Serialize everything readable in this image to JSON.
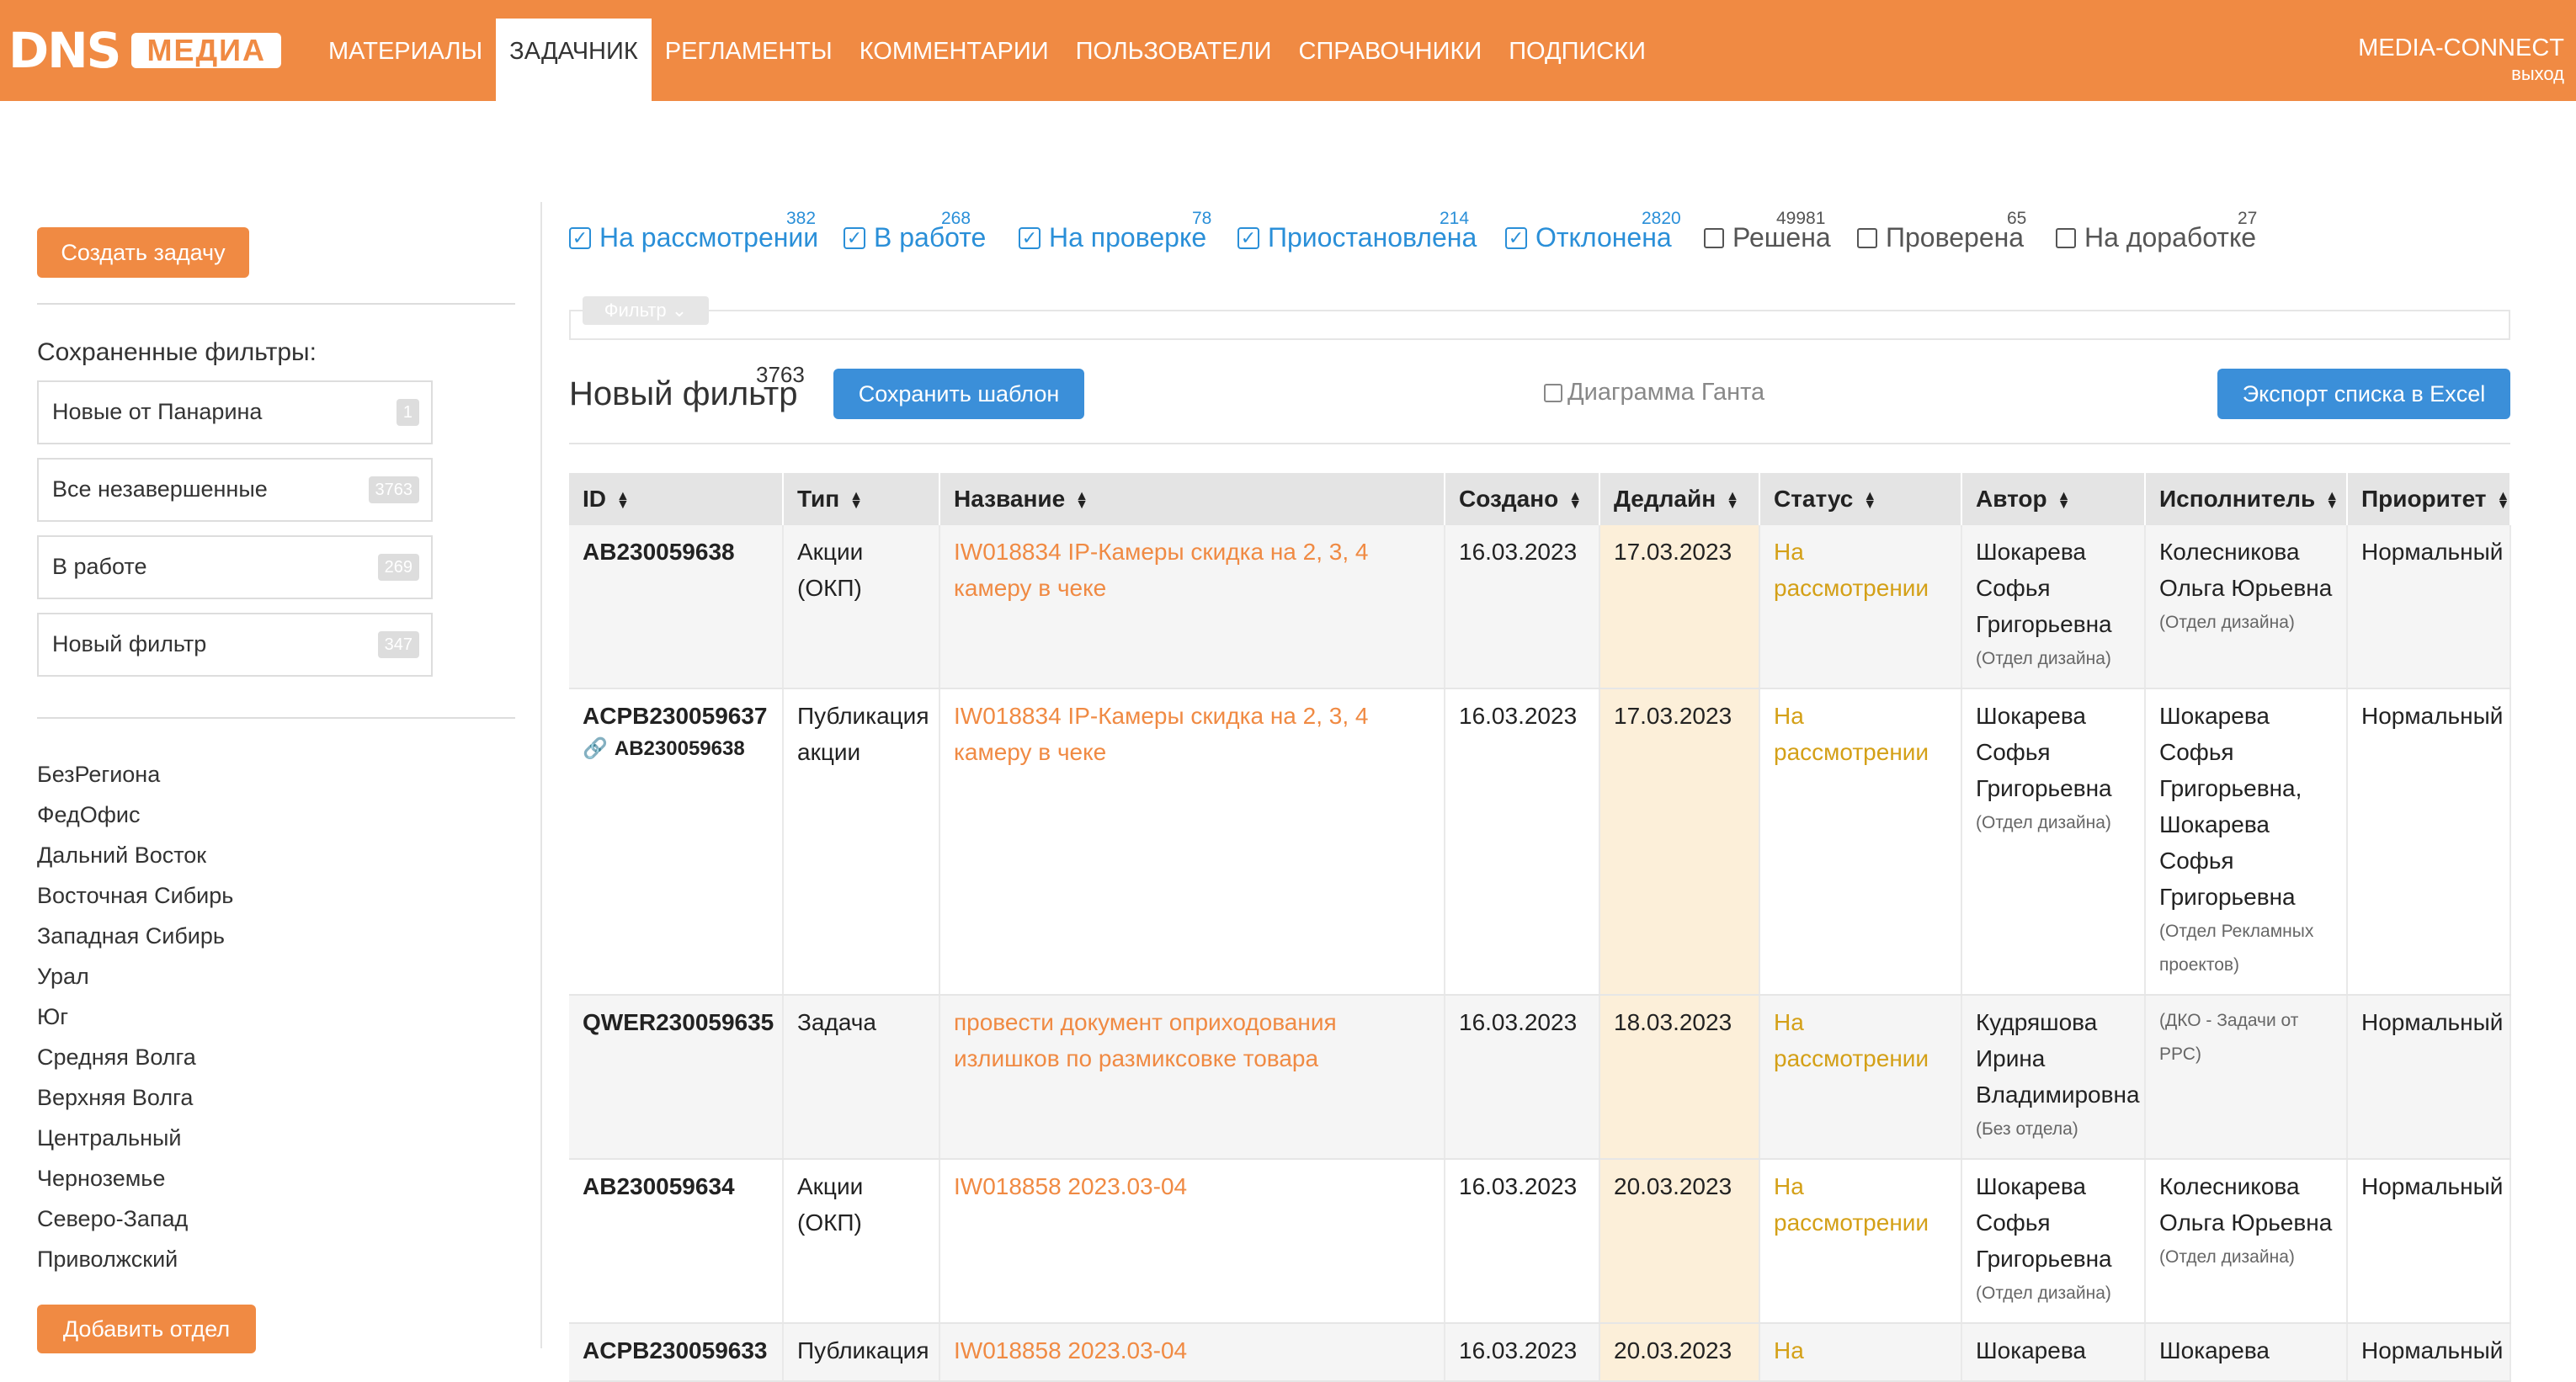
{
  "header": {
    "logo_dns": "DNS",
    "logo_media": "МЕДИА",
    "nav": [
      {
        "label": "МАТЕРИАЛЫ",
        "active": false
      },
      {
        "label": "ЗАДАЧНИК",
        "active": true
      },
      {
        "label": "РЕГЛАМЕНТЫ",
        "active": false
      },
      {
        "label": "КОММЕНТАРИИ",
        "active": false
      },
      {
        "label": "ПОЛЬЗОВАТЕЛИ",
        "active": false
      },
      {
        "label": "СПРАВОЧНИКИ",
        "active": false
      },
      {
        "label": "ПОДПИСКИ",
        "active": false
      }
    ],
    "user_name": "MEDIA-CONNECT",
    "logout": "ВЫХОД",
    "accent_color": "#f08a43"
  },
  "sidebar": {
    "create_button": "Создать задачу",
    "saved_title": "Сохраненные фильтры:",
    "saved_filters": [
      {
        "name": "Новые от Панарина",
        "count": "1"
      },
      {
        "name": "Все незавершенные",
        "count": "3763"
      },
      {
        "name": "В работе",
        "count": "269"
      },
      {
        "name": "Новый фильтр",
        "count": "347"
      }
    ],
    "regions": [
      "БезРегиона",
      "ФедОфис",
      "Дальний Восток",
      "Восточная Сибирь",
      "Западная Сибирь",
      "Урал",
      "Юг",
      "Средняя Волга",
      "Верхняя Волга",
      "Центральный",
      "Черноземье",
      "Северо-Запад",
      "Приволжский"
    ],
    "add_button": "Добавить отдел"
  },
  "statuses": [
    {
      "label": "На рассмотрении",
      "count": "382",
      "checked": true
    },
    {
      "label": "В работе",
      "count": "268",
      "checked": true
    },
    {
      "label": "На проверке",
      "count": "78",
      "checked": true
    },
    {
      "label": "Приостановлена",
      "count": "214",
      "checked": true
    },
    {
      "label": "Отклонена",
      "count": "2820",
      "checked": true
    },
    {
      "label": "Решена",
      "count": "49981",
      "checked": false
    },
    {
      "label": "Проверена",
      "count": "65",
      "checked": false
    },
    {
      "label": "На доработке",
      "count": "27",
      "checked": false
    }
  ],
  "filter_tag": "Фильтр",
  "filter_title": "Новый фильтр",
  "filter_count": "3763",
  "save_template": "Сохранить шаблон",
  "gantt_label": "Диаграмма Ганта",
  "export_button": "Экспорт списка в Excel",
  "table": {
    "columns": [
      "ID",
      "Тип",
      "Название",
      "Создано",
      "Дедлайн",
      "Статус",
      "Автор",
      "Исполнитель",
      "Приоритет"
    ],
    "rows": [
      {
        "id": "AB230059638",
        "sub_id": "",
        "type": "Акции (ОКП)",
        "name": "IW018834 IP-Камеры скидка на 2, 3, 4 камеру в чеке",
        "created": "16.03.2023",
        "deadline": "17.03.2023",
        "status": "На рассмотрении",
        "author": "Шокарева Софья Григорьевна",
        "author_dept": "(Отдел дизайна)",
        "executor": "Колесникова Ольга Юрьевна",
        "executor_dept": "(Отдел дизайна)",
        "priority": "Нормальный"
      },
      {
        "id": "ACPB230059637",
        "sub_id": "AB230059638",
        "type": "Публикация акции",
        "name": "IW018834 IP-Камеры скидка на 2, 3, 4 камеру в чеке",
        "created": "16.03.2023",
        "deadline": "17.03.2023",
        "status": "На рассмотрении",
        "author": "Шокарева Софья Григорьевна",
        "author_dept": "(Отдел дизайна)",
        "executor": "Шокарева Софья Григорьевна, Шокарева Софья Григорьевна",
        "executor_dept": "(Отдел Рекламных проектов)",
        "priority": "Нормальный"
      },
      {
        "id": "QWER230059635",
        "sub_id": "",
        "type": "Задача",
        "name": "провести документ оприходования излишков по размиксовке товара",
        "created": "16.03.2023",
        "deadline": "18.03.2023",
        "status": "На рассмотрении",
        "author": "Кудряшова Ирина Владимировна",
        "author_dept": "(Без отдела)",
        "executor": "",
        "executor_dept": "(ДКО - Задачи от РРС)",
        "priority": "Нормальный"
      },
      {
        "id": "AB230059634",
        "sub_id": "",
        "type": "Акции (ОКП)",
        "name": "IW018858 2023.03-04",
        "created": "16.03.2023",
        "deadline": "20.03.2023",
        "status": "На рассмотрении",
        "author": "Шокарева Софья Григорьевна",
        "author_dept": "(Отдел дизайна)",
        "executor": "Колесникова Ольга Юрьевна",
        "executor_dept": "(Отдел дизайна)",
        "priority": "Нормальный"
      },
      {
        "id": "ACPB230059633",
        "sub_id": "",
        "type": "Публикация",
        "name": "IW018858 2023.03-04",
        "created": "16.03.2023",
        "deadline": "20.03.2023",
        "status": "На",
        "author": "Шокарева",
        "author_dept": "",
        "executor": "Шокарева",
        "executor_dept": "",
        "priority": "Нормальный"
      }
    ]
  }
}
